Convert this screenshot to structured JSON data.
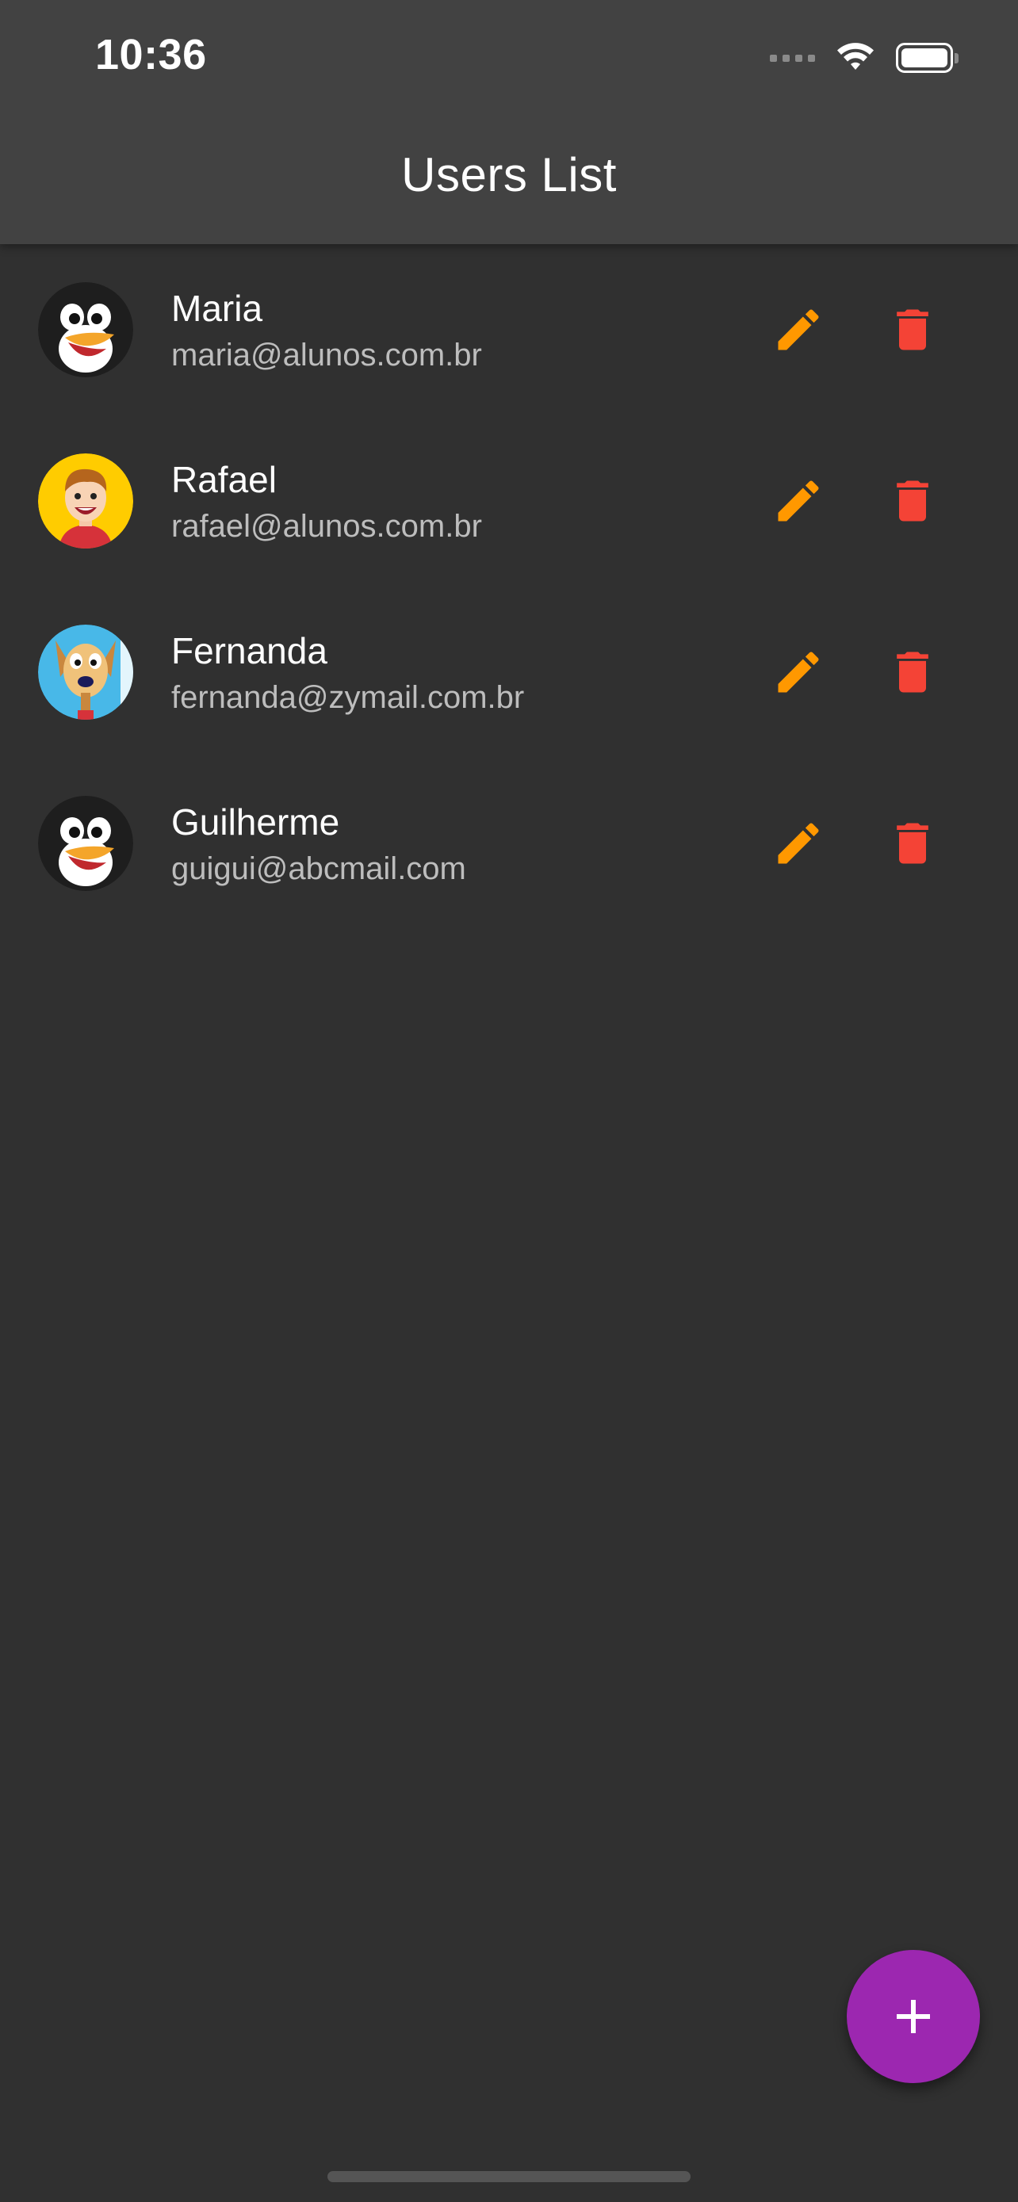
{
  "status_bar": {
    "time": "10:36"
  },
  "app_bar": {
    "title": "Users List"
  },
  "users": [
    {
      "name": "Maria",
      "email": "maria@alunos.com.br",
      "avatar": "penguin"
    },
    {
      "name": "Rafael",
      "email": "rafael@alunos.com.br",
      "avatar": "boy-cartoon"
    },
    {
      "name": "Fernanda",
      "email": "fernanda@zymail.com.br",
      "avatar": "dog-cartoon"
    },
    {
      "name": "Guilherme",
      "email": "guigui@abcmail.com",
      "avatar": "penguin"
    }
  ],
  "icons": {
    "edit": "pencil-icon",
    "delete": "trash-icon",
    "add": "plus-icon"
  },
  "colors": {
    "background": "#303030",
    "app_bar": "#424242",
    "edit": "#ff9800",
    "delete": "#f44336",
    "fab": "#9c27b0"
  }
}
